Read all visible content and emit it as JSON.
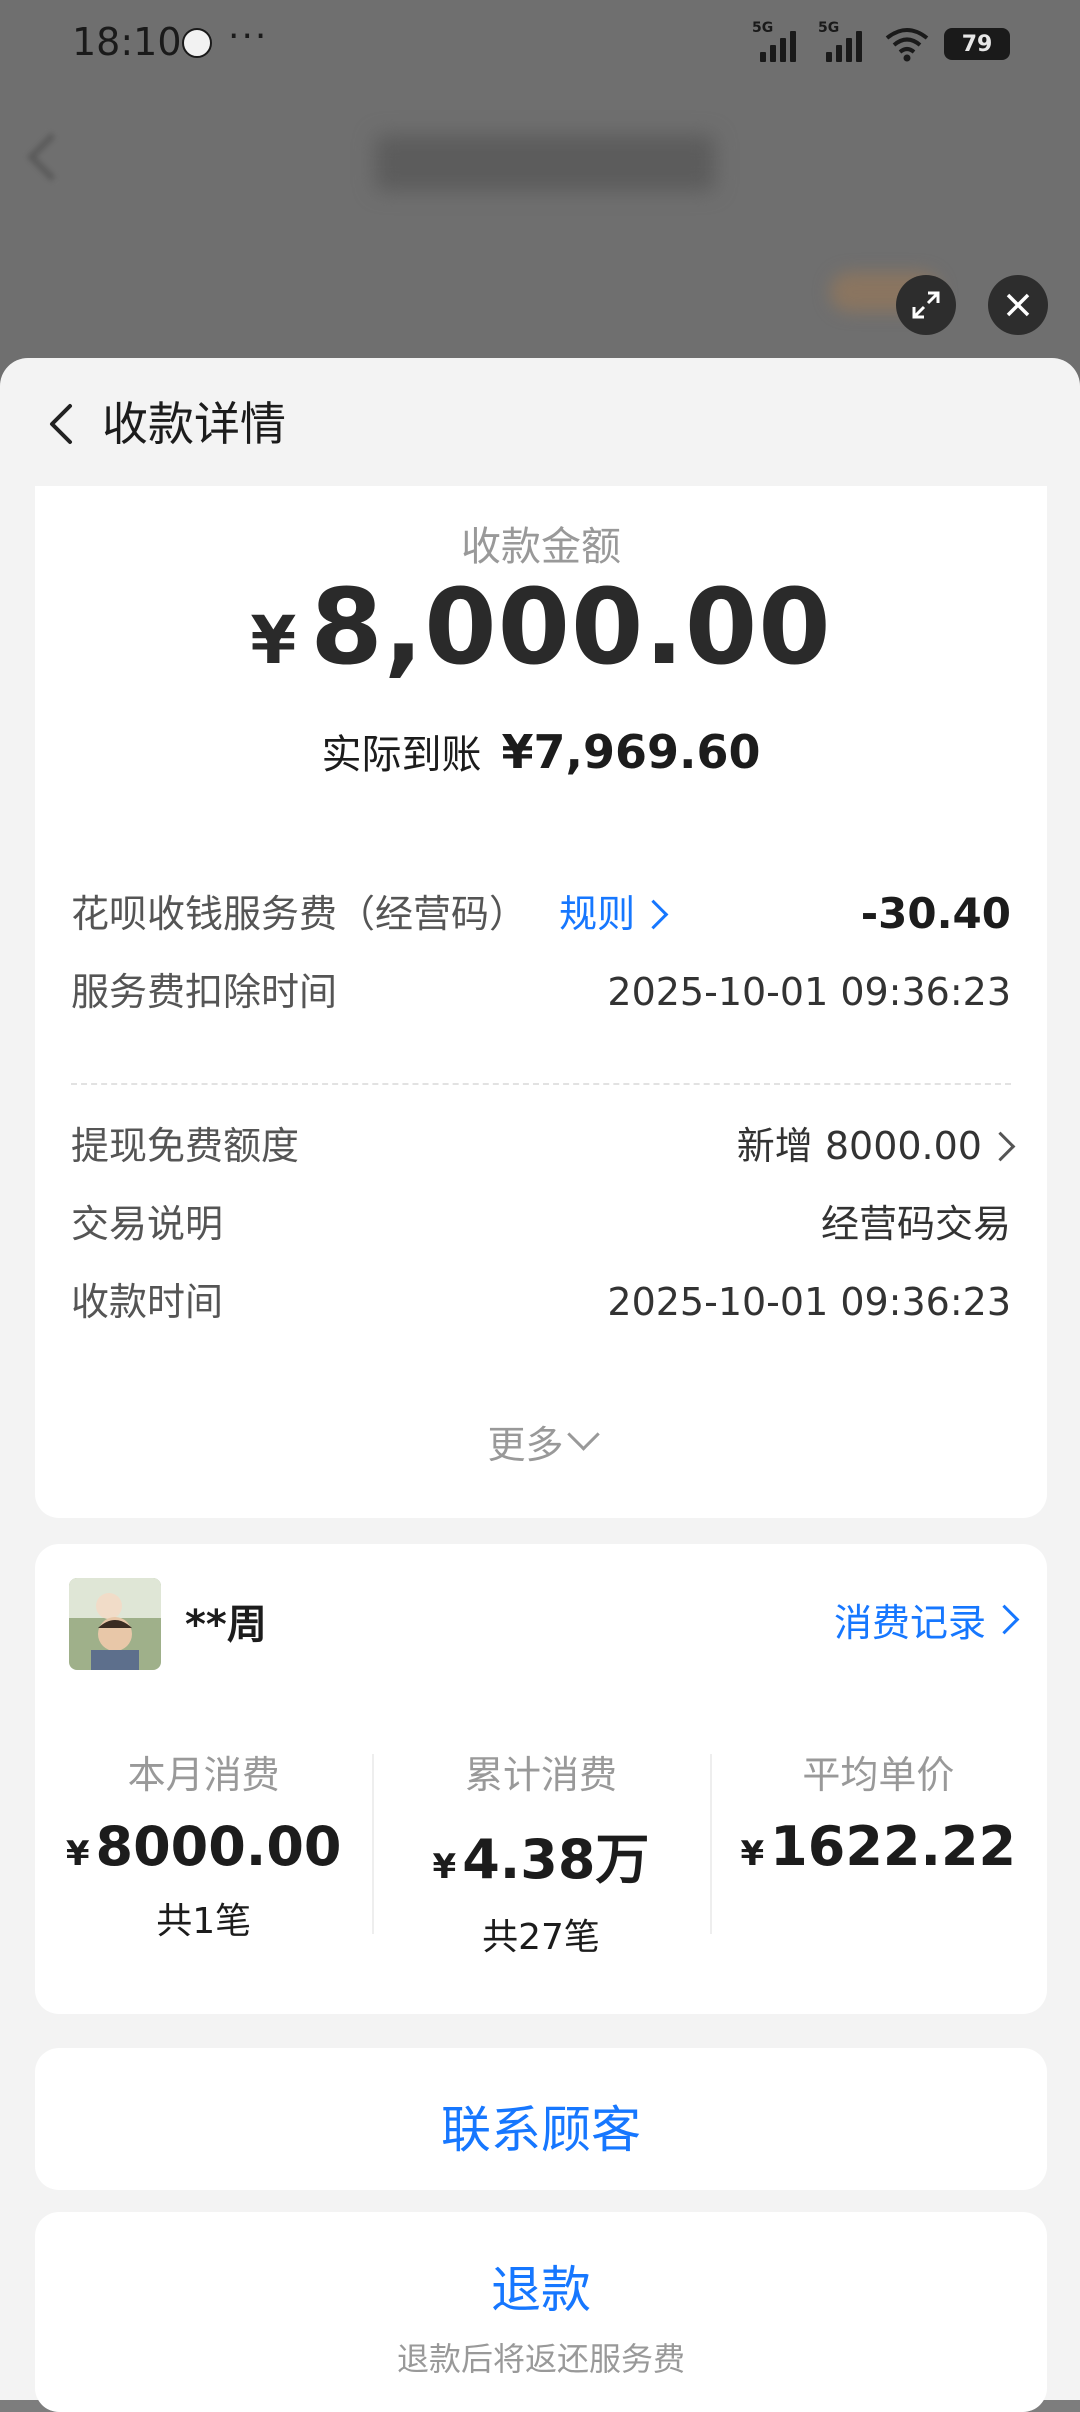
{
  "status_bar": {
    "time": "18:10",
    "dots": "···",
    "signal1": "5G",
    "signal2": "5G",
    "battery": "79"
  },
  "header": {
    "back_icon": "chevron-left-icon",
    "title": "收款详情"
  },
  "payment": {
    "amount_label": "收款金额",
    "currency": "¥",
    "amount": "8,000.00",
    "actual_label": "实际到账",
    "actual_amount": "¥7,969.60",
    "fee_label": "花呗收钱服务费（经营码）",
    "fee_rule_link": "规则",
    "fee_amount": "-30.40",
    "fee_time_label": "服务费扣除时间",
    "fee_time": "2025-10-01 09:36:23",
    "quota_label": "提现免费额度",
    "quota_value": "新增 8000.00",
    "desc_label": "交易说明",
    "desc_value": "经营码交易",
    "time_label": "收款时间",
    "time_value": "2025-10-01 09:36:23",
    "more": "更多"
  },
  "customer": {
    "name": "**周",
    "records_link": "消费记录",
    "stats": [
      {
        "label": "本月消费",
        "currency": "¥",
        "value": "8000.00",
        "count": "共1笔"
      },
      {
        "label": "累计消费",
        "currency": "¥",
        "value": "4.38万",
        "count": "共27笔"
      },
      {
        "label": "平均单价",
        "currency": "¥",
        "value": "1622.22",
        "count": ""
      }
    ]
  },
  "actions": {
    "contact": "联系顾客",
    "refund": "退款",
    "refund_note": "退款后将返还服务费"
  },
  "colors": {
    "accent": "#1677ff",
    "text": "#1c1c1c",
    "muted": "#999999",
    "sheet_bg": "#f3f3f3",
    "card_bg": "#ffffff"
  }
}
